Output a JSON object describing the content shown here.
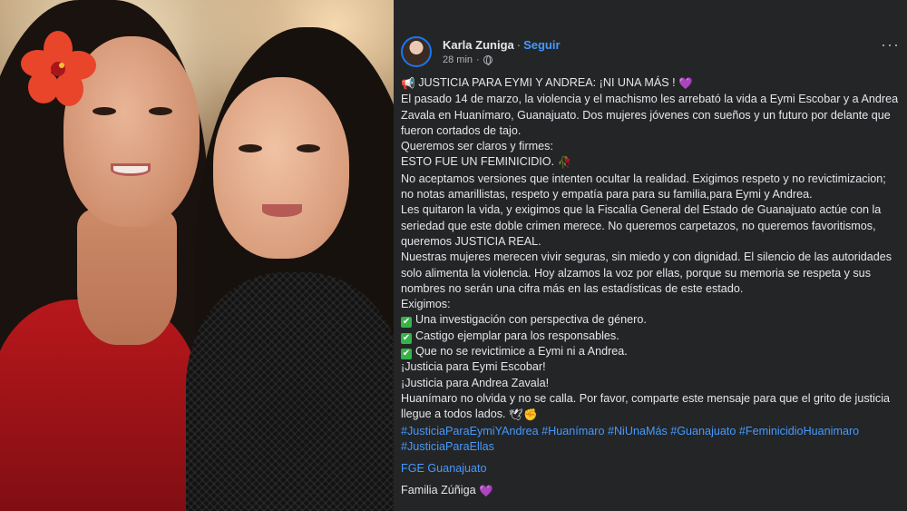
{
  "post": {
    "author": "Karla Zuniga",
    "separator": "·",
    "follow": "Seguir",
    "time": "28 min",
    "meta_separator": "·",
    "more": "···",
    "icons": {
      "megaphone": "📢",
      "heart_purple": "💜",
      "rose": "🥀",
      "check": "✔",
      "dove": "🕊",
      "fist": "✊"
    },
    "lines": [
      "JUSTICIA PARA EYMI Y ANDREA: ¡NI UNA MÁS !",
      "El pasado 14 de marzo, la violencia y el machismo les arrebató la vida a Eymi Escobar y a Andrea Zavala en Huanímaro, Guanajuato. Dos mujeres jóvenes con sueños y un futuro por delante que fueron cortados de tajo.",
      "Queremos ser claros y firmes:",
      "ESTO FUE UN FEMINICIDIO.",
      "No aceptamos versiones que intenten ocultar la realidad. Exigimos respeto y no revictimizacion; no notas amarillistas, respeto y empatía para para su familia,para Eymi y Andrea.",
      "Les quitaron la vida, y exigimos que la Fiscalía General del Estado de Guanajuato actúe con la seriedad que este doble crimen merece. No queremos carpetazos, no queremos favoritismos, queremos JUSTICIA REAL.",
      "Nuestras mujeres merecen vivir seguras, sin miedo y con dignidad. El silencio de las autoridades solo alimenta la violencia. Hoy alzamos la voz por ellas, porque su memoria se respeta y sus nombres no serán una cifra más en las estadísticas de este estado.",
      "Exigimos:"
    ],
    "demands": [
      "Una investigación con perspectiva de género.",
      "Castigo ejemplar para los responsables.",
      "Que no se revictimice a Eymi ni a Andrea."
    ],
    "closing": [
      "¡Justicia para Eymi Escobar!",
      "¡Justicia para Andrea Zavala!",
      "Huanímaro no olvida y no se calla. Por favor, comparte este mensaje para que el grito de justicia llegue a todos lados."
    ],
    "hashtags": "#JusticiaParaEymiYAndrea #Huanímaro #NiUnaMás #Guanajuato #FeminicidioHuanimaro #JusticiaParaEllas",
    "mention": "FGE Guanajuato",
    "signature": "Familia Zúñiga"
  }
}
